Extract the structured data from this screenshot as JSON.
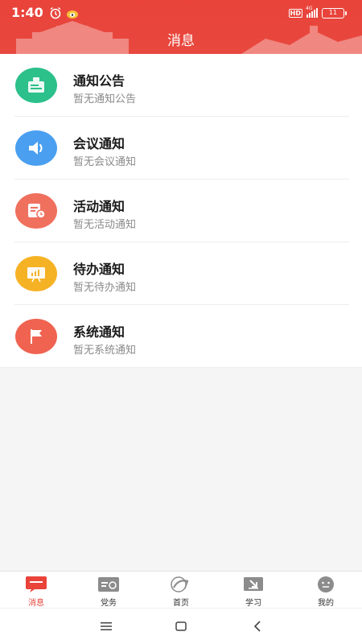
{
  "status_bar": {
    "time": "1:40",
    "hd_label": "HD",
    "network": "4G",
    "battery_level": "11"
  },
  "header": {
    "title": "消息"
  },
  "messages": [
    {
      "title": "通知公告",
      "subtitle": "暂无通知公告",
      "icon": "notice-board-icon",
      "color": "#2cc08a"
    },
    {
      "title": "会议通知",
      "subtitle": "暂无会议通知",
      "icon": "speaker-icon",
      "color": "#4a9ff0"
    },
    {
      "title": "活动通知",
      "subtitle": "暂无活动通知",
      "icon": "calendar-clock-icon",
      "color": "#f0705e"
    },
    {
      "title": "待办通知",
      "subtitle": "暂无待办通知",
      "icon": "presentation-board-icon",
      "color": "#f6b225"
    },
    {
      "title": "系统通知",
      "subtitle": "暂无系统通知",
      "icon": "flag-icon",
      "color": "#ef6350"
    }
  ],
  "tabbar": {
    "tabs": [
      {
        "label": "消息",
        "icon": "message-icon",
        "active": true
      },
      {
        "label": "党务",
        "icon": "party-affairs-icon",
        "active": false
      },
      {
        "label": "首页",
        "icon": "home-logo-icon",
        "active": false
      },
      {
        "label": "学习",
        "icon": "study-icon",
        "active": false
      },
      {
        "label": "我的",
        "icon": "profile-face-icon",
        "active": false
      }
    ]
  },
  "colors": {
    "accent": "#e9433a",
    "tab_inactive_icon": "#8c8c8c"
  }
}
